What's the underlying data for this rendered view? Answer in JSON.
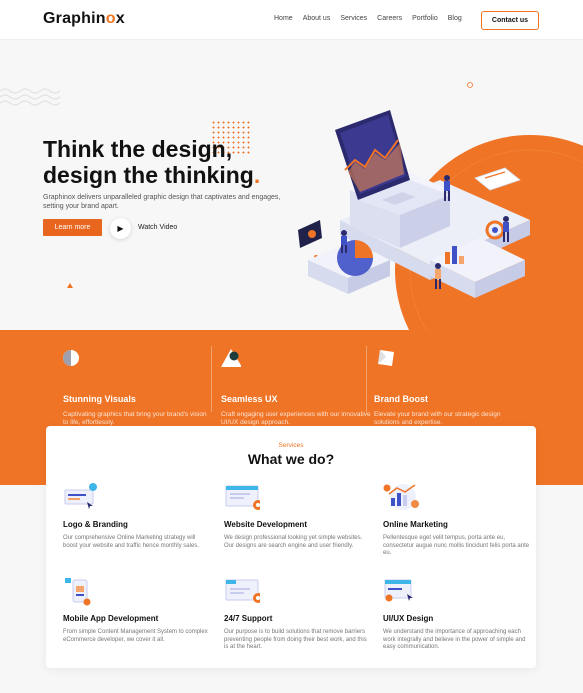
{
  "header": {
    "logo": "Graphinox",
    "nav": [
      "Home",
      "About us",
      "Services",
      "Careers",
      "Portfolio",
      "Blog"
    ],
    "contact_label": "Contact us"
  },
  "hero": {
    "title_line1": "Think the design,",
    "title_line2": "design the thinking",
    "title_dot": ".",
    "description": "Graphinox delivers unparalleled graphic design that captivates and engages, setting your brand apart.",
    "learn_more": "Learn more",
    "watch_video": "Watch Video"
  },
  "features": [
    {
      "title": "Stunning Visuals",
      "desc": "Captivating graphics that bring your brand's vision to life, effortlessly."
    },
    {
      "title": "Seamless UX",
      "desc": "Craft engaging user experiences with our innovative UI/UX design approach."
    },
    {
      "title": "Brand Boost",
      "desc": "Elevate your brand with our strategic design solutions and expertise."
    }
  ],
  "services": {
    "kicker": "Services",
    "title": "What we do?",
    "items": [
      {
        "title": "Logo & Branding",
        "desc": "Our comprehensive Online Marketing strategy will boost your website and traffic hence monthly sales."
      },
      {
        "title": "Website Development",
        "desc": "We design professional looking yet simple websites. Our designs are search engine and user friendly."
      },
      {
        "title": "Online Marketing",
        "desc": "Pellentesque eget velit tempus, porta ante eu, consectetur augue nunc mollis tincidunt felis porta ante eu."
      },
      {
        "title": "Mobile App Development",
        "desc": "From simple Content Management System to complex eCommerce developer, we cover it all."
      },
      {
        "title": "24/7 Support",
        "desc": "Our purpose is to build solutions that remove barriers preventing people from doing their best work, and this is at the heart."
      },
      {
        "title": "UI/UX Design",
        "desc": "We understand the importance of approaching each work integrally and believe in the power of simple and easy communication."
      }
    ]
  },
  "colors": {
    "accent": "#ef7426",
    "text": "#111111"
  }
}
